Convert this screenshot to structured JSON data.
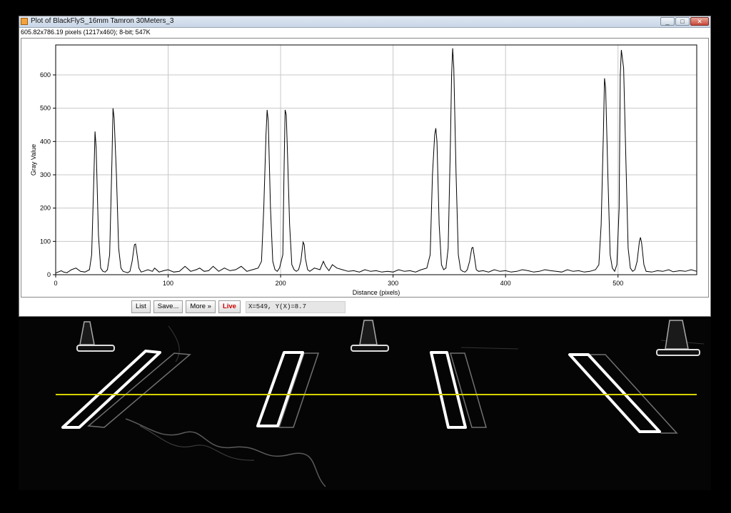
{
  "window": {
    "title": "Plot of BlackFlyS_16mm Tamron 30Meters_3",
    "info": "605.82x786.19 pixels (1217x460); 8-bit; 547K",
    "controls": [
      "_",
      "□",
      "✕"
    ]
  },
  "toolbar": {
    "list_label": "List",
    "save_label": "Save...",
    "more_label": "More »",
    "live_label": "Live",
    "coords": "X=549, Y(X)=8.7"
  },
  "chart_data": {
    "type": "line",
    "xlabel": "Distance (pixels)",
    "ylabel": "Gray Value",
    "xlim": [
      0,
      570
    ],
    "ylim": [
      0,
      690
    ],
    "xticks": [
      0,
      100,
      200,
      300,
      400,
      500
    ],
    "yticks": [
      0,
      100,
      200,
      300,
      400,
      500,
      600
    ],
    "grid": true,
    "series": [
      {
        "color": "#000000",
        "x": [
          0,
          5,
          7,
          10,
          14,
          18,
          22,
          26,
          30,
          32,
          34,
          35,
          36,
          38,
          40,
          42,
          44,
          46,
          48,
          50,
          51,
          52,
          54,
          56,
          58,
          60,
          62,
          64,
          66,
          68,
          70,
          71,
          72,
          74,
          76,
          78,
          82,
          86,
          88,
          92,
          96,
          100,
          105,
          110,
          115,
          120,
          125,
          128,
          132,
          136,
          140,
          145,
          150,
          155,
          160,
          165,
          170,
          175,
          180,
          183,
          185,
          187,
          188,
          189,
          191,
          193,
          195,
          197,
          199,
          202,
          203,
          204,
          205,
          206,
          208,
          210,
          212,
          214,
          216,
          218,
          220,
          221,
          222,
          224,
          226,
          230,
          235,
          238,
          240,
          243,
          246,
          250,
          255,
          260,
          265,
          270,
          275,
          280,
          285,
          290,
          295,
          300,
          305,
          310,
          315,
          320,
          325,
          330,
          333,
          335,
          337,
          338,
          339,
          341,
          343,
          345,
          347,
          349,
          351,
          352,
          353,
          354,
          356,
          358,
          360,
          362,
          364,
          366,
          368,
          370,
          371,
          372,
          374,
          376,
          380,
          385,
          390,
          395,
          400,
          405,
          410,
          415,
          420,
          425,
          430,
          435,
          440,
          445,
          450,
          455,
          460,
          465,
          470,
          475,
          480,
          483,
          485,
          487,
          488,
          489,
          491,
          493,
          495,
          497,
          499,
          501,
          502,
          503,
          505,
          507,
          509,
          511,
          513,
          515,
          517,
          519,
          520,
          521,
          523,
          525,
          530,
          535,
          540,
          545,
          549,
          555,
          560,
          565,
          570
        ],
        "values": [
          5,
          12,
          8,
          6,
          15,
          20,
          10,
          8,
          15,
          60,
          300,
          430,
          380,
          120,
          20,
          10,
          8,
          15,
          60,
          340,
          500,
          470,
          300,
          80,
          20,
          10,
          8,
          6,
          10,
          40,
          90,
          92,
          70,
          20,
          8,
          10,
          15,
          10,
          20,
          8,
          12,
          15,
          8,
          10,
          25,
          10,
          15,
          20,
          10,
          12,
          25,
          10,
          20,
          12,
          15,
          25,
          10,
          15,
          20,
          40,
          200,
          420,
          495,
          460,
          200,
          40,
          15,
          10,
          20,
          60,
          300,
          495,
          480,
          380,
          150,
          30,
          15,
          10,
          15,
          40,
          98,
          90,
          50,
          15,
          10,
          20,
          15,
          40,
          25,
          12,
          30,
          20,
          15,
          10,
          12,
          8,
          15,
          10,
          12,
          8,
          10,
          8,
          15,
          10,
          12,
          8,
          15,
          20,
          60,
          300,
          420,
          440,
          400,
          150,
          30,
          15,
          20,
          80,
          400,
          600,
          680,
          620,
          300,
          60,
          15,
          10,
          8,
          15,
          40,
          80,
          82,
          60,
          15,
          10,
          12,
          8,
          15,
          10,
          12,
          8,
          10,
          15,
          12,
          8,
          10,
          15,
          12,
          10,
          8,
          15,
          10,
          12,
          8,
          10,
          15,
          30,
          150,
          420,
          590,
          560,
          300,
          60,
          20,
          10,
          30,
          200,
          600,
          675,
          620,
          350,
          80,
          20,
          10,
          15,
          40,
          100,
          112,
          95,
          30,
          10,
          8,
          12,
          10,
          15,
          8.7,
          12,
          10,
          15,
          10
        ]
      }
    ]
  }
}
